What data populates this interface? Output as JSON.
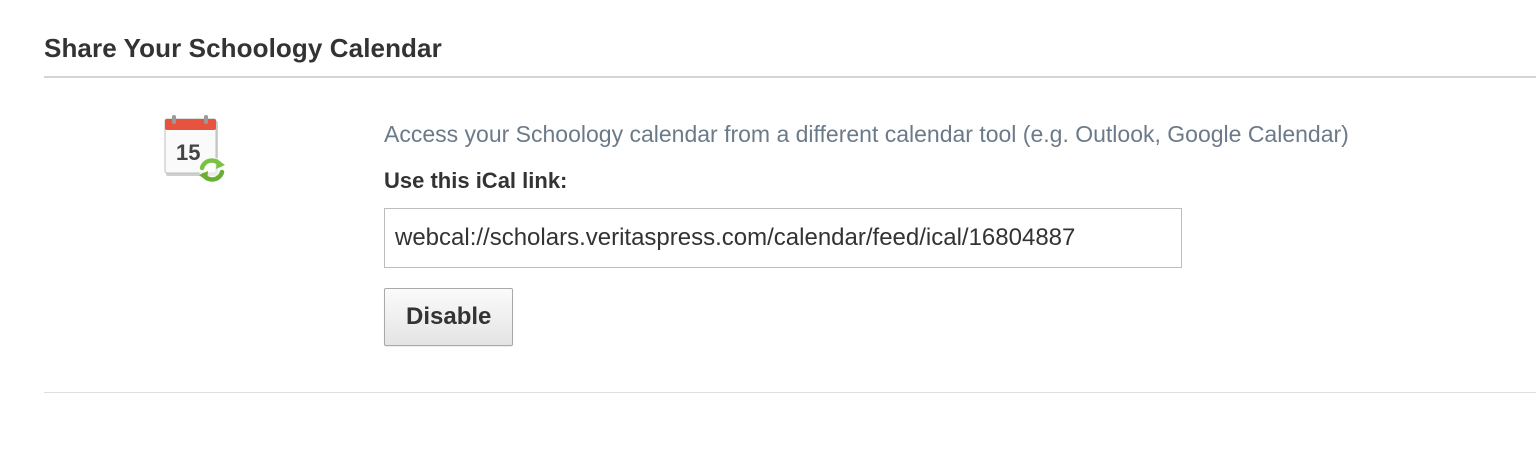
{
  "section": {
    "title": "Share Your Schoology Calendar"
  },
  "calendar_icon": {
    "name": "calendar-sync-icon",
    "day_number": "15",
    "colors": {
      "header": "#e8533f",
      "sync_arrows": "#7cc242"
    }
  },
  "share": {
    "description": "Access your Schoology calendar from a different calendar tool (e.g. Outlook, Google Calendar)",
    "link_label": "Use this iCal link:",
    "ical_link": "webcal://scholars.veritaspress.com/calendar/feed/ical/16804887",
    "disable_label": "Disable"
  }
}
